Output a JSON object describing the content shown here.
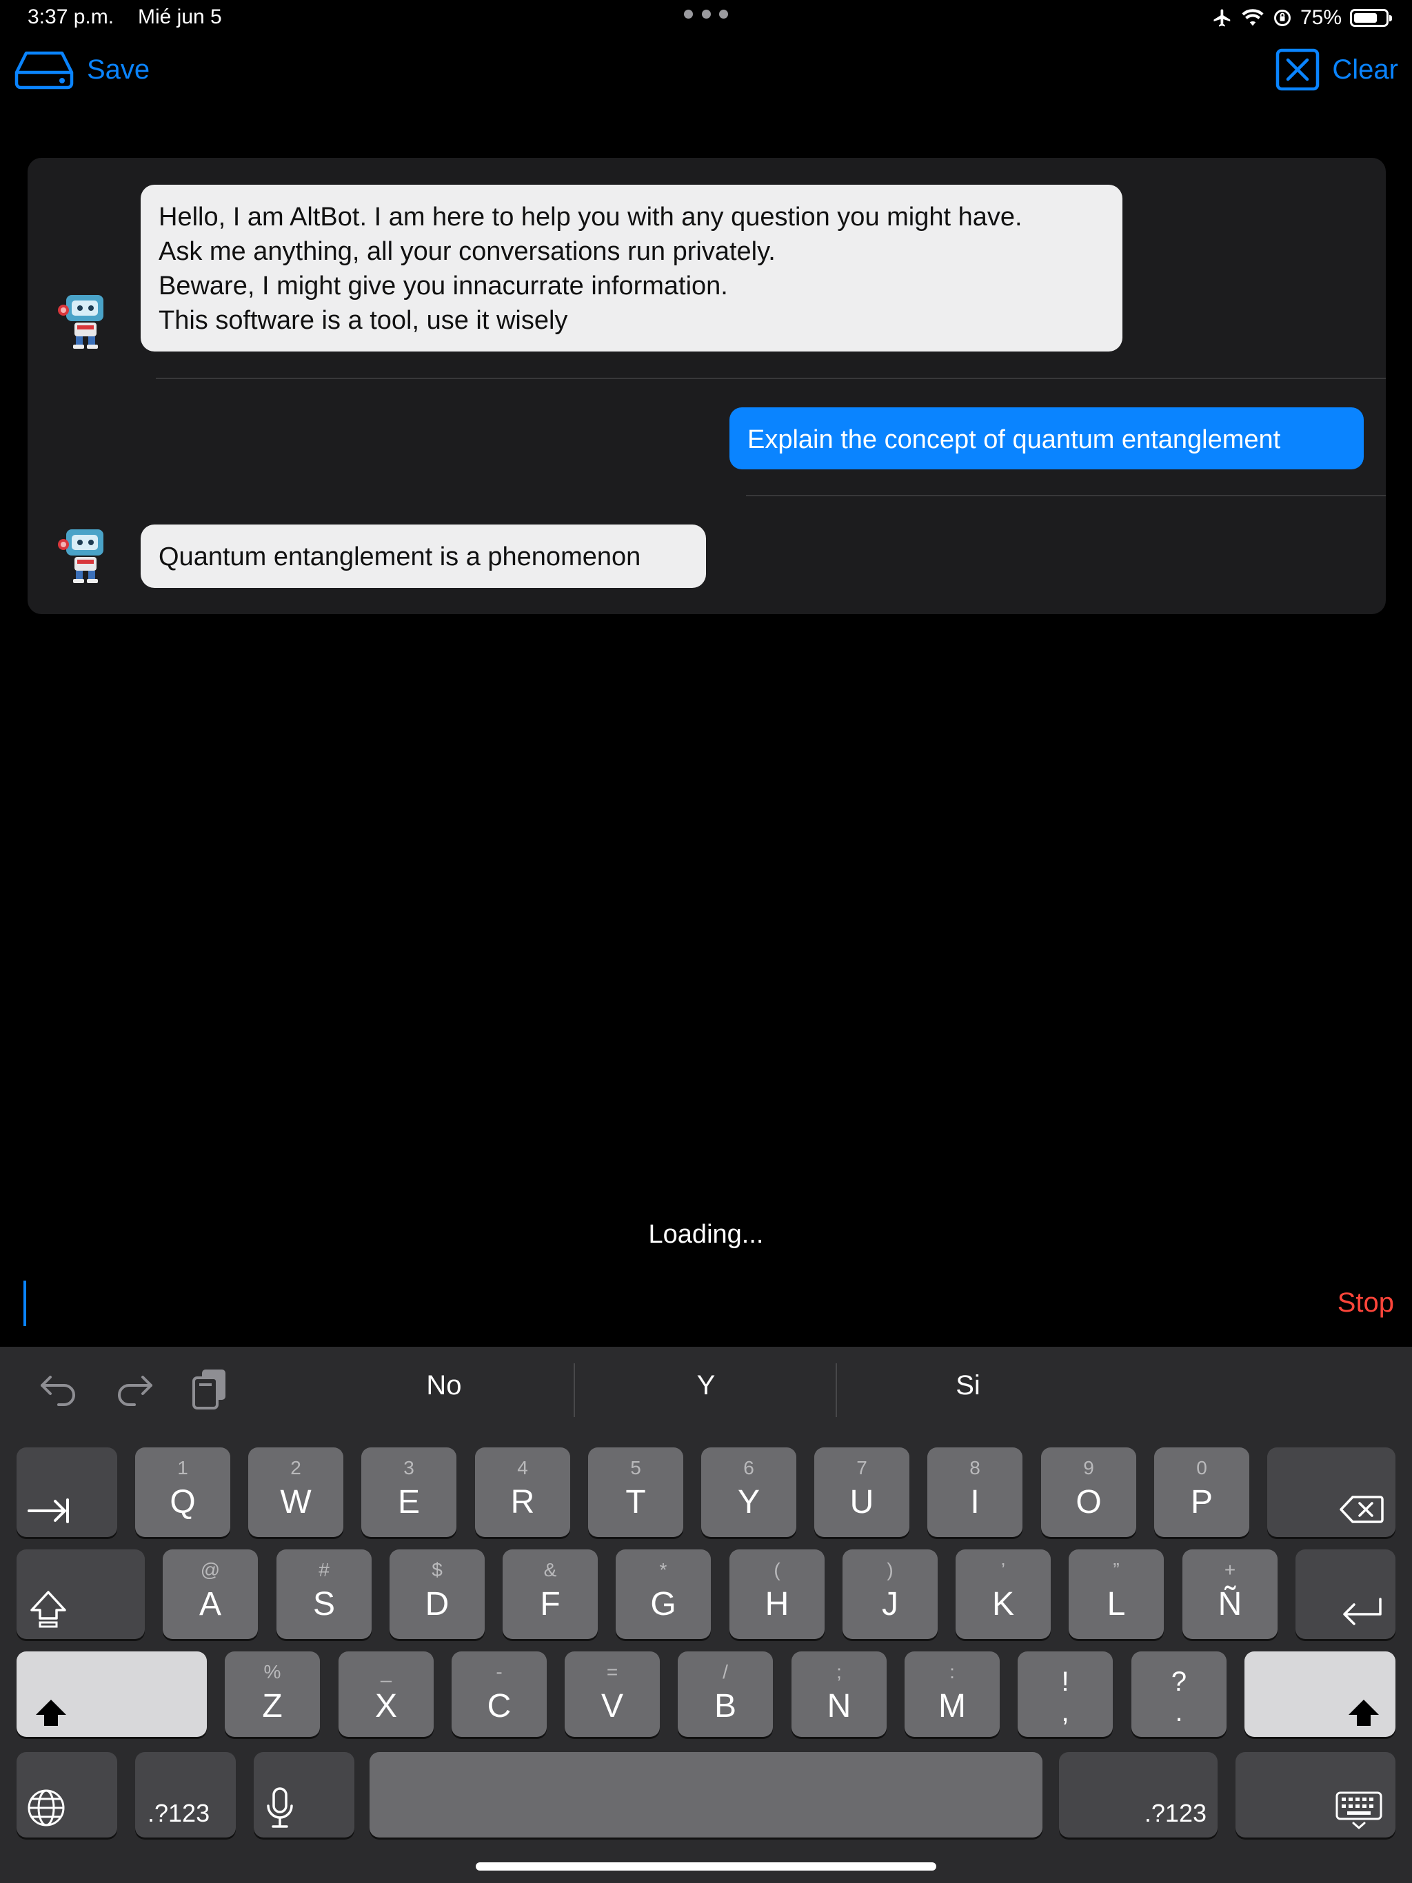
{
  "status_bar": {
    "time": "3:37 p.m.",
    "date": "Mié jun 5",
    "battery": "75%",
    "battery_level": 0.75
  },
  "toolbar": {
    "save_label": "Save",
    "clear_label": "Clear",
    "accent_color": "#0a84ff"
  },
  "chat": {
    "greeting": "Hello, I am AltBot. I am here to help you with any question you might have.\nAsk me anything, all your conversations run privately.\nBeware, I might give you innacurrate information.\nThis software is a tool, use it wisely",
    "user_message": "Explain the concept of quantum entanglement",
    "bot_reply": "Quantum entanglement is a phenomenon"
  },
  "loading_text": "Loading...",
  "stop_label": "Stop",
  "keyboard": {
    "suggestions": [
      "No",
      "Y",
      "Si"
    ],
    "row1": [
      [
        "1",
        "Q"
      ],
      [
        "2",
        "W"
      ],
      [
        "3",
        "E"
      ],
      [
        "4",
        "R"
      ],
      [
        "5",
        "T"
      ],
      [
        "6",
        "Y"
      ],
      [
        "7",
        "U"
      ],
      [
        "8",
        "I"
      ],
      [
        "9",
        "O"
      ],
      [
        "0",
        "P"
      ]
    ],
    "row2": [
      [
        "@",
        "A"
      ],
      [
        "#",
        "S"
      ],
      [
        "$",
        "D"
      ],
      [
        "&",
        "F"
      ],
      [
        "*",
        "G"
      ],
      [
        "(",
        "H"
      ],
      [
        ")",
        "J"
      ],
      [
        "’",
        "K"
      ],
      [
        "”",
        "L"
      ],
      [
        "+",
        "Ñ"
      ]
    ],
    "row3": [
      [
        "%",
        "Z"
      ],
      [
        "_",
        "X"
      ],
      [
        "-",
        "C"
      ],
      [
        "=",
        "V"
      ],
      [
        "/",
        "B"
      ],
      [
        ";",
        "N"
      ],
      [
        ":",
        "M"
      ]
    ],
    "row3_punct": [
      [
        "!",
        ","
      ],
      [
        "?",
        "."
      ]
    ],
    "numbers_label": ".?123"
  }
}
